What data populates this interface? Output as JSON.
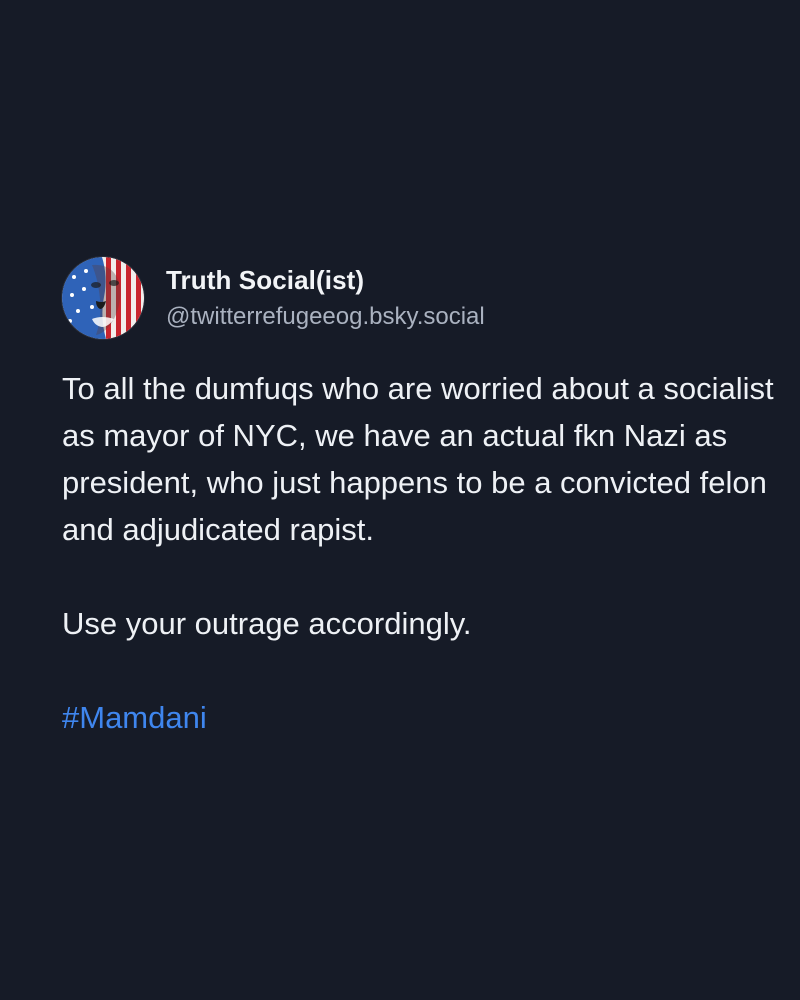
{
  "post": {
    "author": {
      "display_name": "Truth Social(ist)",
      "handle": "@twitterrefugeeog.bsky.social",
      "avatar_icon": "american-flag-face-avatar-icon"
    },
    "paragraphs": [
      "To all the dumfuqs who are worried about a socialist as mayor of NYC, we have an actual fkn Nazi as president, who just happens to be a convicted felon and adjudicated rapist.",
      "Use your outrage accordingly."
    ],
    "hashtag": "#Mamdani"
  },
  "colors": {
    "background": "#161b27",
    "text": "#eef1f5",
    "handle": "#aab2c0",
    "hashtag": "#3f86ee"
  }
}
